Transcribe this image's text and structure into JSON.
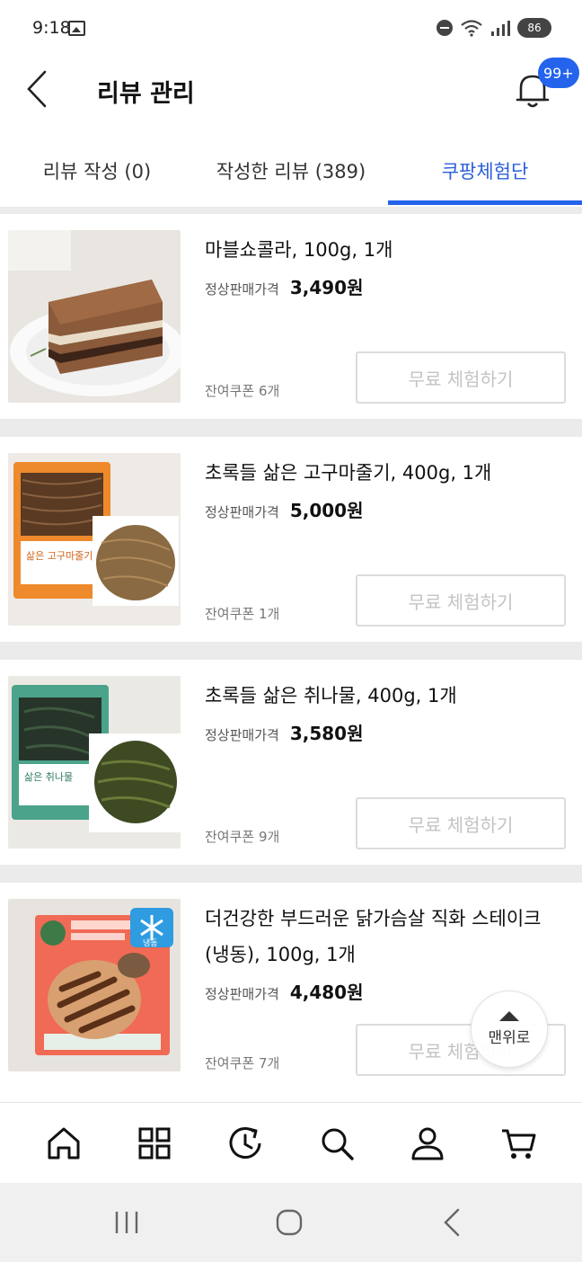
{
  "status_bar": {
    "time": "9:18",
    "battery": "86"
  },
  "header": {
    "title": "리뷰 관리",
    "notification_badge": "99+"
  },
  "tabs": [
    {
      "label": "리뷰 작성 (0)"
    },
    {
      "label": "작성한 리뷰 (389)"
    },
    {
      "label": "쿠팡체험단"
    }
  ],
  "products": [
    {
      "name": "마블쇼콜라, 100g, 1개",
      "price_label": "정상판매가격",
      "price": "3,490원",
      "coupon": "잔여쿠폰 6개",
      "button": "무료 체험하기"
    },
    {
      "name": "초록들 삶은 고구마줄기, 400g, 1개",
      "price_label": "정상판매가격",
      "price": "5,000원",
      "coupon": "잔여쿠폰 1개",
      "button": "무료 체험하기",
      "package_text": "삶은 고구마줄기"
    },
    {
      "name": "초록들 삶은 취나물, 400g, 1개",
      "price_label": "정상판매가격",
      "price": "3,580원",
      "coupon": "잔여쿠폰 9개",
      "button": "무료 체험하기",
      "package_text": "삶은 취나물"
    },
    {
      "name": "더건강한 부드러운 닭가슴살 직화 스테이크(냉동), 100g, 1개",
      "price_label": "정상판매가격",
      "price": "4,480원",
      "coupon": "잔여쿠폰 7개",
      "button": "무료 체험하기",
      "package_text": "냉동"
    }
  ],
  "scroll_top": {
    "label": "맨위로"
  },
  "bottom_nav": {
    "icons": [
      "home-icon",
      "categories-icon",
      "recent-icon",
      "search-icon",
      "my-account-icon",
      "cart-icon"
    ]
  },
  "system_nav": {
    "icons": [
      "recents-icon",
      "home-circle-icon",
      "back-icon"
    ]
  },
  "colors": {
    "accent": "#2463eb",
    "divider": "#ebebeb",
    "button_text": "#c3c3c3"
  }
}
